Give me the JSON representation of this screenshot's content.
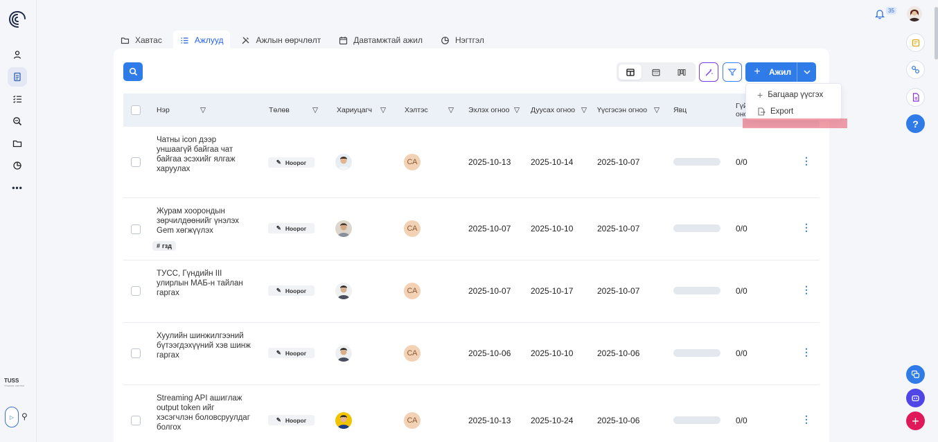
{
  "notifications": {
    "count": "35"
  },
  "sidebar": {
    "brand": "TUSS",
    "brand_sub": "Ухаалаг систем"
  },
  "tabs": [
    {
      "label": "Хавтас"
    },
    {
      "label": "Ажлууд"
    },
    {
      "label": "Ажлын өөрчлөлт"
    },
    {
      "label": "Давтамжтай ажил"
    },
    {
      "label": "Нэгтгэл"
    }
  ],
  "toolbar": {
    "add_label": "Ажил"
  },
  "dropdown": {
    "items": [
      {
        "label": "Багцаар үүсгэх"
      },
      {
        "label": "Export"
      }
    ]
  },
  "table": {
    "headers": {
      "name": "Нэр",
      "status": "Төлөв",
      "assignee": "Хариуцагч",
      "reviewer": "Хэлтэс",
      "start": "Эхлэх огноо",
      "end": "Дуусах огноо",
      "created": "Үүсгэсэн огноо",
      "progress": "Явц",
      "perf": "Гүй оно"
    },
    "rows": [
      {
        "name": "Чатны icon дээр уншаагүй байгаа чат байгаа эсэхийг ялгаж харуулах",
        "tag": "",
        "status": "Ноорог",
        "reviewer": "СА",
        "start": "2025-10-13",
        "end": "2025-10-14",
        "created": "2025-10-07",
        "count": "0/0"
      },
      {
        "name": "Журам хоорондын зөрчилдөөнийг үнэлэх Gem хөгжүүлэх",
        "tag": "гзд",
        "status": "Ноорог",
        "reviewer": "СА",
        "start": "2025-10-07",
        "end": "2025-10-10",
        "created": "2025-10-07",
        "count": "0/0"
      },
      {
        "name": "ТУСС, Гүндийн III улирлын МАБ-н тайлан гаргах",
        "tag": "",
        "status": "Ноорог",
        "reviewer": "СА",
        "start": "2025-10-07",
        "end": "2025-10-17",
        "created": "2025-10-07",
        "count": "0/0"
      },
      {
        "name": "Хуулийн шинжилгээний бүтээгдэхүүний хэв шинж гаргах",
        "tag": "",
        "status": "Ноорог",
        "reviewer": "СА",
        "start": "2025-10-06",
        "end": "2025-10-10",
        "created": "2025-10-06",
        "count": "0/0"
      },
      {
        "name": "Streaming API ашиглаж output token ийг хэсэгчлэн боловсруулдаг болгох",
        "tag": "",
        "status": "Ноорог",
        "reviewer": "СА",
        "start": "2025-10-13",
        "end": "2025-10-24",
        "created": "2025-10-06",
        "count": "0/0"
      }
    ]
  },
  "colors": {
    "accent": "#2f7be8",
    "highlight": "#e75064",
    "purple": "#7c3aed"
  }
}
